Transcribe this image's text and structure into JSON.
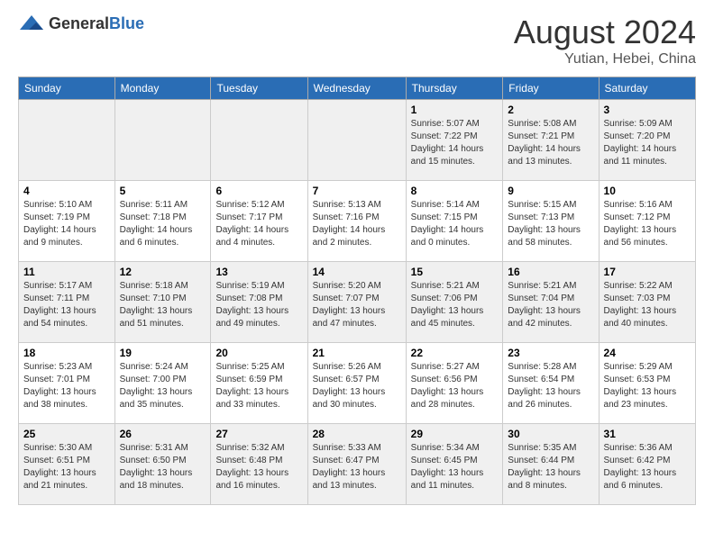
{
  "header": {
    "logo_general": "General",
    "logo_blue": "Blue",
    "month_year": "August 2024",
    "location": "Yutian, Hebei, China"
  },
  "columns": [
    "Sunday",
    "Monday",
    "Tuesday",
    "Wednesday",
    "Thursday",
    "Friday",
    "Saturday"
  ],
  "weeks": [
    {
      "days": [
        {
          "num": "",
          "info": ""
        },
        {
          "num": "",
          "info": ""
        },
        {
          "num": "",
          "info": ""
        },
        {
          "num": "",
          "info": ""
        },
        {
          "num": "1",
          "info": "Sunrise: 5:07 AM\nSunset: 7:22 PM\nDaylight: 14 hours\nand 15 minutes."
        },
        {
          "num": "2",
          "info": "Sunrise: 5:08 AM\nSunset: 7:21 PM\nDaylight: 14 hours\nand 13 minutes."
        },
        {
          "num": "3",
          "info": "Sunrise: 5:09 AM\nSunset: 7:20 PM\nDaylight: 14 hours\nand 11 minutes."
        }
      ]
    },
    {
      "days": [
        {
          "num": "4",
          "info": "Sunrise: 5:10 AM\nSunset: 7:19 PM\nDaylight: 14 hours\nand 9 minutes."
        },
        {
          "num": "5",
          "info": "Sunrise: 5:11 AM\nSunset: 7:18 PM\nDaylight: 14 hours\nand 6 minutes."
        },
        {
          "num": "6",
          "info": "Sunrise: 5:12 AM\nSunset: 7:17 PM\nDaylight: 14 hours\nand 4 minutes."
        },
        {
          "num": "7",
          "info": "Sunrise: 5:13 AM\nSunset: 7:16 PM\nDaylight: 14 hours\nand 2 minutes."
        },
        {
          "num": "8",
          "info": "Sunrise: 5:14 AM\nSunset: 7:15 PM\nDaylight: 14 hours\nand 0 minutes."
        },
        {
          "num": "9",
          "info": "Sunrise: 5:15 AM\nSunset: 7:13 PM\nDaylight: 13 hours\nand 58 minutes."
        },
        {
          "num": "10",
          "info": "Sunrise: 5:16 AM\nSunset: 7:12 PM\nDaylight: 13 hours\nand 56 minutes."
        }
      ]
    },
    {
      "days": [
        {
          "num": "11",
          "info": "Sunrise: 5:17 AM\nSunset: 7:11 PM\nDaylight: 13 hours\nand 54 minutes."
        },
        {
          "num": "12",
          "info": "Sunrise: 5:18 AM\nSunset: 7:10 PM\nDaylight: 13 hours\nand 51 minutes."
        },
        {
          "num": "13",
          "info": "Sunrise: 5:19 AM\nSunset: 7:08 PM\nDaylight: 13 hours\nand 49 minutes."
        },
        {
          "num": "14",
          "info": "Sunrise: 5:20 AM\nSunset: 7:07 PM\nDaylight: 13 hours\nand 47 minutes."
        },
        {
          "num": "15",
          "info": "Sunrise: 5:21 AM\nSunset: 7:06 PM\nDaylight: 13 hours\nand 45 minutes."
        },
        {
          "num": "16",
          "info": "Sunrise: 5:21 AM\nSunset: 7:04 PM\nDaylight: 13 hours\nand 42 minutes."
        },
        {
          "num": "17",
          "info": "Sunrise: 5:22 AM\nSunset: 7:03 PM\nDaylight: 13 hours\nand 40 minutes."
        }
      ]
    },
    {
      "days": [
        {
          "num": "18",
          "info": "Sunrise: 5:23 AM\nSunset: 7:01 PM\nDaylight: 13 hours\nand 38 minutes."
        },
        {
          "num": "19",
          "info": "Sunrise: 5:24 AM\nSunset: 7:00 PM\nDaylight: 13 hours\nand 35 minutes."
        },
        {
          "num": "20",
          "info": "Sunrise: 5:25 AM\nSunset: 6:59 PM\nDaylight: 13 hours\nand 33 minutes."
        },
        {
          "num": "21",
          "info": "Sunrise: 5:26 AM\nSunset: 6:57 PM\nDaylight: 13 hours\nand 30 minutes."
        },
        {
          "num": "22",
          "info": "Sunrise: 5:27 AM\nSunset: 6:56 PM\nDaylight: 13 hours\nand 28 minutes."
        },
        {
          "num": "23",
          "info": "Sunrise: 5:28 AM\nSunset: 6:54 PM\nDaylight: 13 hours\nand 26 minutes."
        },
        {
          "num": "24",
          "info": "Sunrise: 5:29 AM\nSunset: 6:53 PM\nDaylight: 13 hours\nand 23 minutes."
        }
      ]
    },
    {
      "days": [
        {
          "num": "25",
          "info": "Sunrise: 5:30 AM\nSunset: 6:51 PM\nDaylight: 13 hours\nand 21 minutes."
        },
        {
          "num": "26",
          "info": "Sunrise: 5:31 AM\nSunset: 6:50 PM\nDaylight: 13 hours\nand 18 minutes."
        },
        {
          "num": "27",
          "info": "Sunrise: 5:32 AM\nSunset: 6:48 PM\nDaylight: 13 hours\nand 16 minutes."
        },
        {
          "num": "28",
          "info": "Sunrise: 5:33 AM\nSunset: 6:47 PM\nDaylight: 13 hours\nand 13 minutes."
        },
        {
          "num": "29",
          "info": "Sunrise: 5:34 AM\nSunset: 6:45 PM\nDaylight: 13 hours\nand 11 minutes."
        },
        {
          "num": "30",
          "info": "Sunrise: 5:35 AM\nSunset: 6:44 PM\nDaylight: 13 hours\nand 8 minutes."
        },
        {
          "num": "31",
          "info": "Sunrise: 5:36 AM\nSunset: 6:42 PM\nDaylight: 13 hours\nand 6 minutes."
        }
      ]
    }
  ]
}
